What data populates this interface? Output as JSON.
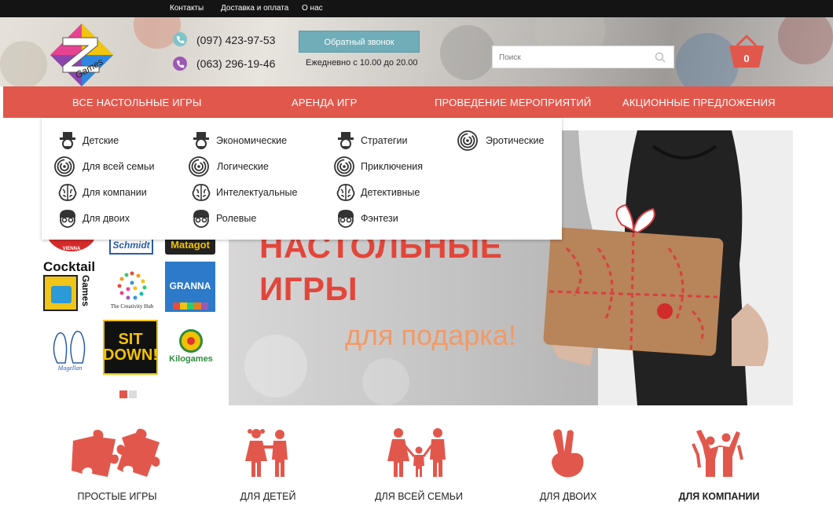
{
  "topbar": {
    "links": [
      "Контакты",
      "Доставка и оплата",
      "О нас"
    ]
  },
  "header": {
    "logo_text": "Games",
    "phones": [
      "(097) 423-97-53",
      "(063) 296-19-46"
    ],
    "callback_label": "Обратный звонок",
    "hours": "Ежедневно с 10.00 до 20.00",
    "search_placeholder": "Поиск",
    "cart_count": "0"
  },
  "nav": {
    "items": [
      "ВСЕ НАСТОЛЬНЫЕ ИГРЫ",
      "АРЕНДА ИГР",
      "ПРОВЕДЕНИЕ МЕРОПРИЯТИЙ",
      "АКЦИОННЫЕ ПРЕДЛОЖЕНИЯ"
    ]
  },
  "dropdown": {
    "col1": [
      "Детские",
      "Для всей семьи",
      "Для компании",
      "Для двоих"
    ],
    "col2": [
      "Экономические",
      "Логические",
      "Интелектуальные",
      "Ролевые"
    ],
    "col3": [
      "Стратегии",
      "Приключения",
      "Детективные",
      "Фэнтези"
    ],
    "col4": [
      "Эротические"
    ]
  },
  "brands": {
    "schmidt": "Schmidt",
    "matagot": "Matagot",
    "cocktail": "Cocktail",
    "cocktail_games": "Games",
    "creativity": "The Creativity Hub",
    "granna": "GRANNA",
    "magellan": "Magellan",
    "sitdown_1": "SIT",
    "sitdown_2": "DOWN!",
    "kilogames": "Kilogames"
  },
  "banner": {
    "title_line1": "НАСТОЛЬНЫЕ",
    "title_line2": "ИГРЫ",
    "subtitle": "для подарка!"
  },
  "categories": [
    "ПРОСТЫЕ ИГРЫ",
    "ДЛЯ ДЕТЕЙ",
    "ДЛЯ ВСЕЙ СЕМЬИ",
    "ДЛЯ ДВОИХ",
    "ДЛЯ КОМПАНИИ"
  ],
  "colors": {
    "accent": "#e2574c",
    "callback": "#6fadb8",
    "topbar": "#141414"
  }
}
